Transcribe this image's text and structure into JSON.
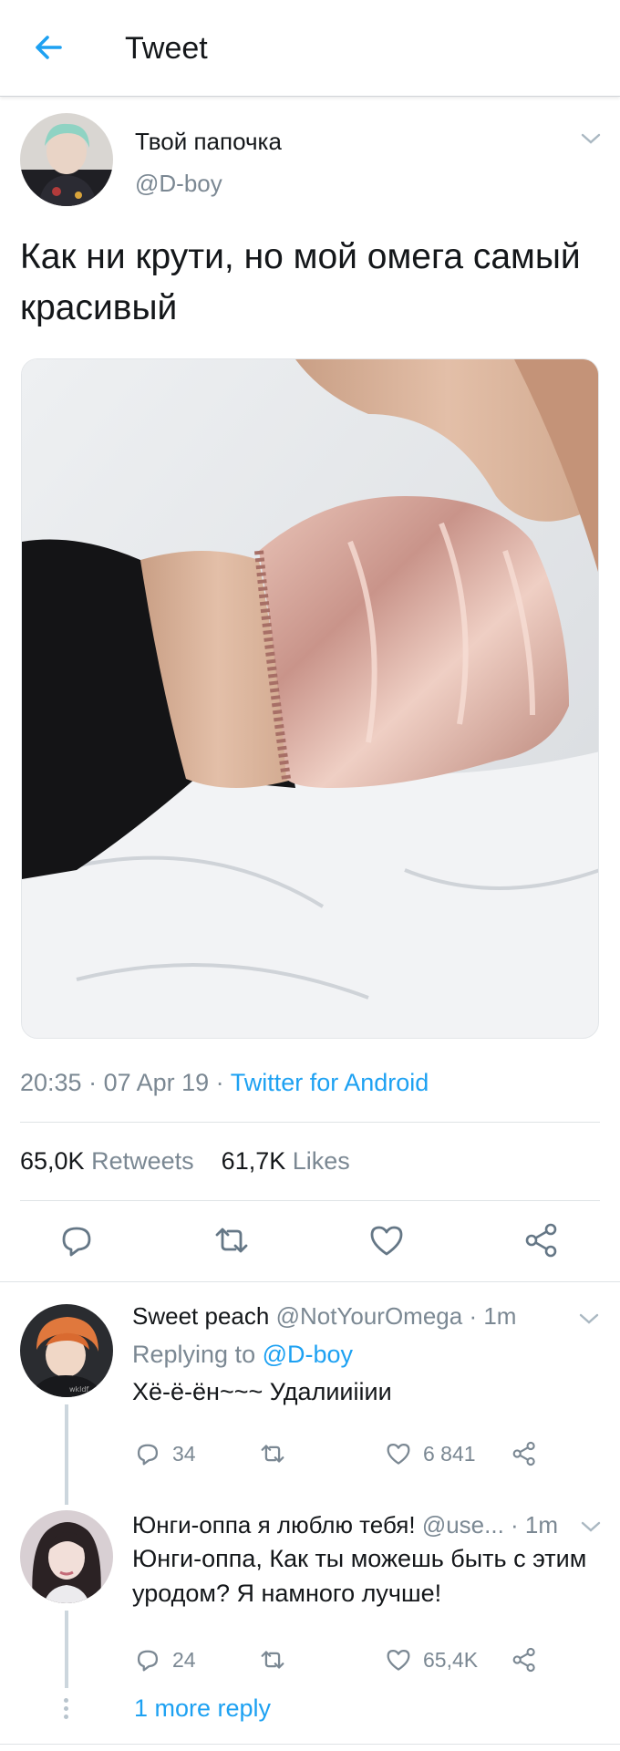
{
  "header": {
    "title": "Tweet",
    "back_icon": "arrow-left-icon"
  },
  "tweet": {
    "author_name": "Твой папочка",
    "author_handle": "@D-boy",
    "text": "Как ни крути, но мой омега самый красивый",
    "time": "20:35",
    "date": "07 Apr 19",
    "source": "Twitter for Android",
    "retweets_count": "65,0K",
    "retweets_label": "Retweets",
    "likes_count": "61,7K",
    "likes_label": "Likes"
  },
  "replies": [
    {
      "name": "Sweet peach",
      "handle": "@NotYourOmega",
      "time": "1m",
      "replying_prefix": "Replying to",
      "replying_to": "@D-boy",
      "text": "Хё-ё-ён~~~ Удалииiiии",
      "reply_count": "34",
      "like_count": "6 841"
    },
    {
      "name": "Юнги-оппа я люблю тебя!",
      "handle": "@use...",
      "time": "1m",
      "text": "Юнги-оппа, Как ты можешь быть с этим уродом? Я намного лучше!",
      "reply_count": "24",
      "like_count": "65,4K"
    }
  ],
  "more_replies": "1 more reply",
  "colors": {
    "accent": "#1da1f2",
    "secondary_text": "#7b8893",
    "divider": "#dfe3e6"
  }
}
